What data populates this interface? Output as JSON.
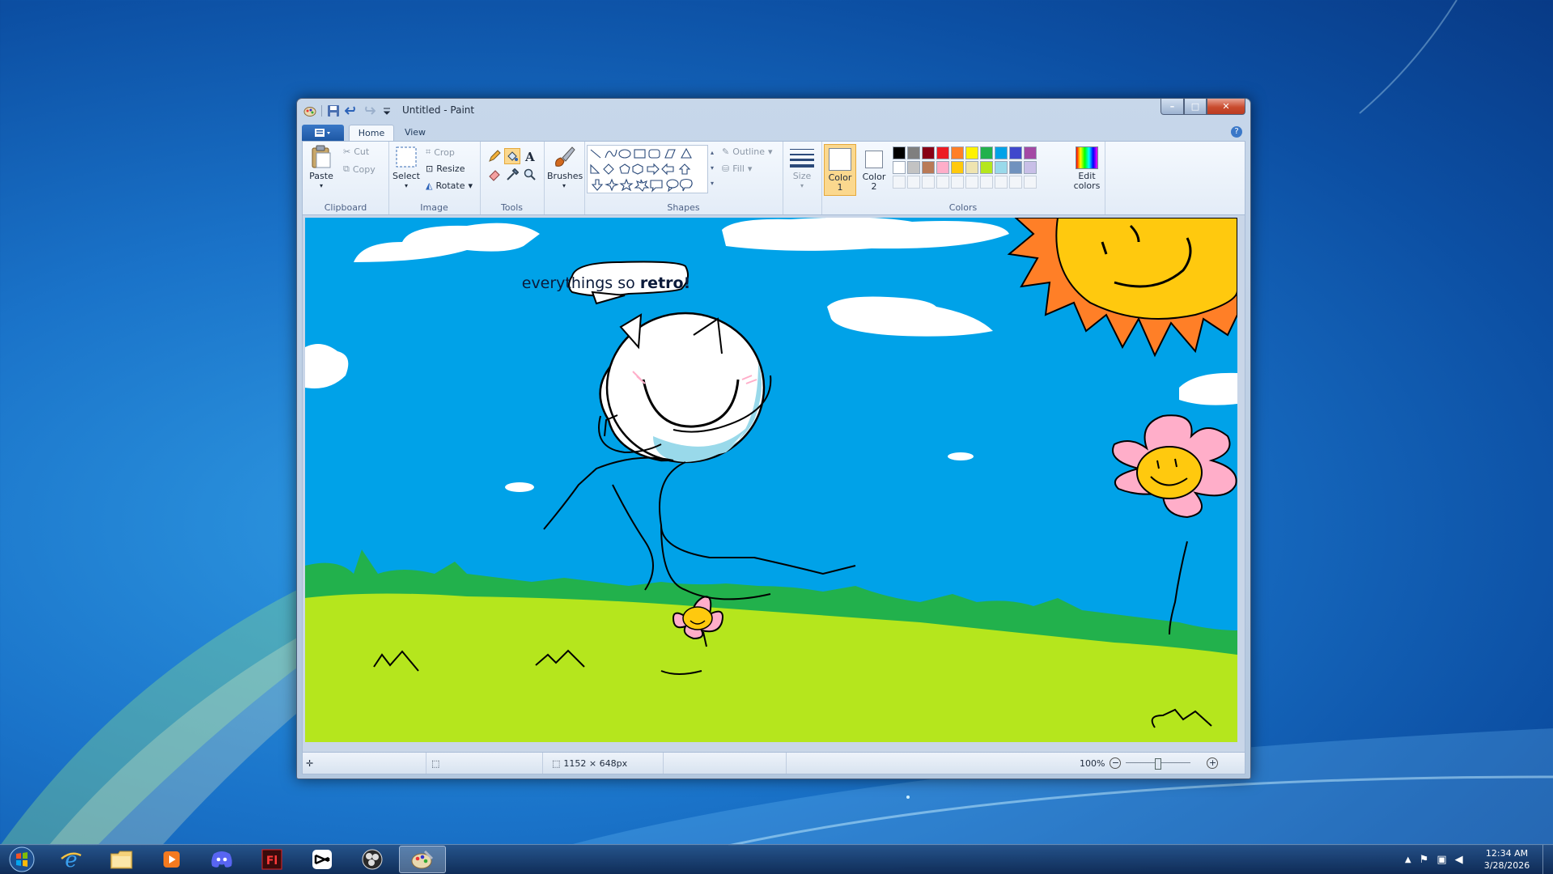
{
  "window": {
    "title": "Untitled - Paint",
    "controls": {
      "minimize": "–",
      "maximize": "□",
      "close": "✕"
    }
  },
  "tabs": [
    {
      "label": "Home"
    },
    {
      "label": "View"
    }
  ],
  "ribbon": {
    "clipboard": {
      "label": "Clipboard",
      "paste": "Paste",
      "cut": "Cut",
      "copy": "Copy"
    },
    "image": {
      "label": "Image",
      "select": "Select",
      "crop": "Crop",
      "resize": "Resize",
      "rotate": "Rotate"
    },
    "tools": {
      "label": "Tools"
    },
    "brushes": {
      "label": "Brushes"
    },
    "shapes": {
      "label": "Shapes",
      "outline": "Outline",
      "fill": "Fill"
    },
    "size": {
      "label": "Size"
    },
    "colors": {
      "label": "Colors",
      "color1": {
        "label": "Color",
        "num": "1",
        "value": "#ffffff"
      },
      "color2": {
        "label": "Color",
        "num": "2",
        "value": "#ffffff"
      },
      "edit_label_1": "Edit",
      "edit_label_2": "colors",
      "palette_row1": [
        "#000000",
        "#7f7f7f",
        "#880015",
        "#ed1c24",
        "#ff7f27",
        "#fff200",
        "#22b14c",
        "#00a2e8",
        "#3f48cc",
        "#a349a4"
      ],
      "palette_row2": [
        "#ffffff",
        "#c3c3c3",
        "#b97a57",
        "#ffaec9",
        "#ffc90e",
        "#efe4b0",
        "#b5e61d",
        "#99d9ea",
        "#7092be",
        "#c8bfe7"
      ]
    }
  },
  "canvas": {
    "speech_text_1": "everythings so ",
    "speech_text_2": "retro!"
  },
  "statusbar": {
    "dimensions": "1152 × 648px",
    "zoom": "100%"
  },
  "taskbar": {
    "apps": [
      "internet-explorer",
      "file-explorer",
      "media-player",
      "discord",
      "flash",
      "capcut",
      "obs",
      "paint"
    ],
    "time": "12:34 AM",
    "date": "3/28/2026"
  }
}
